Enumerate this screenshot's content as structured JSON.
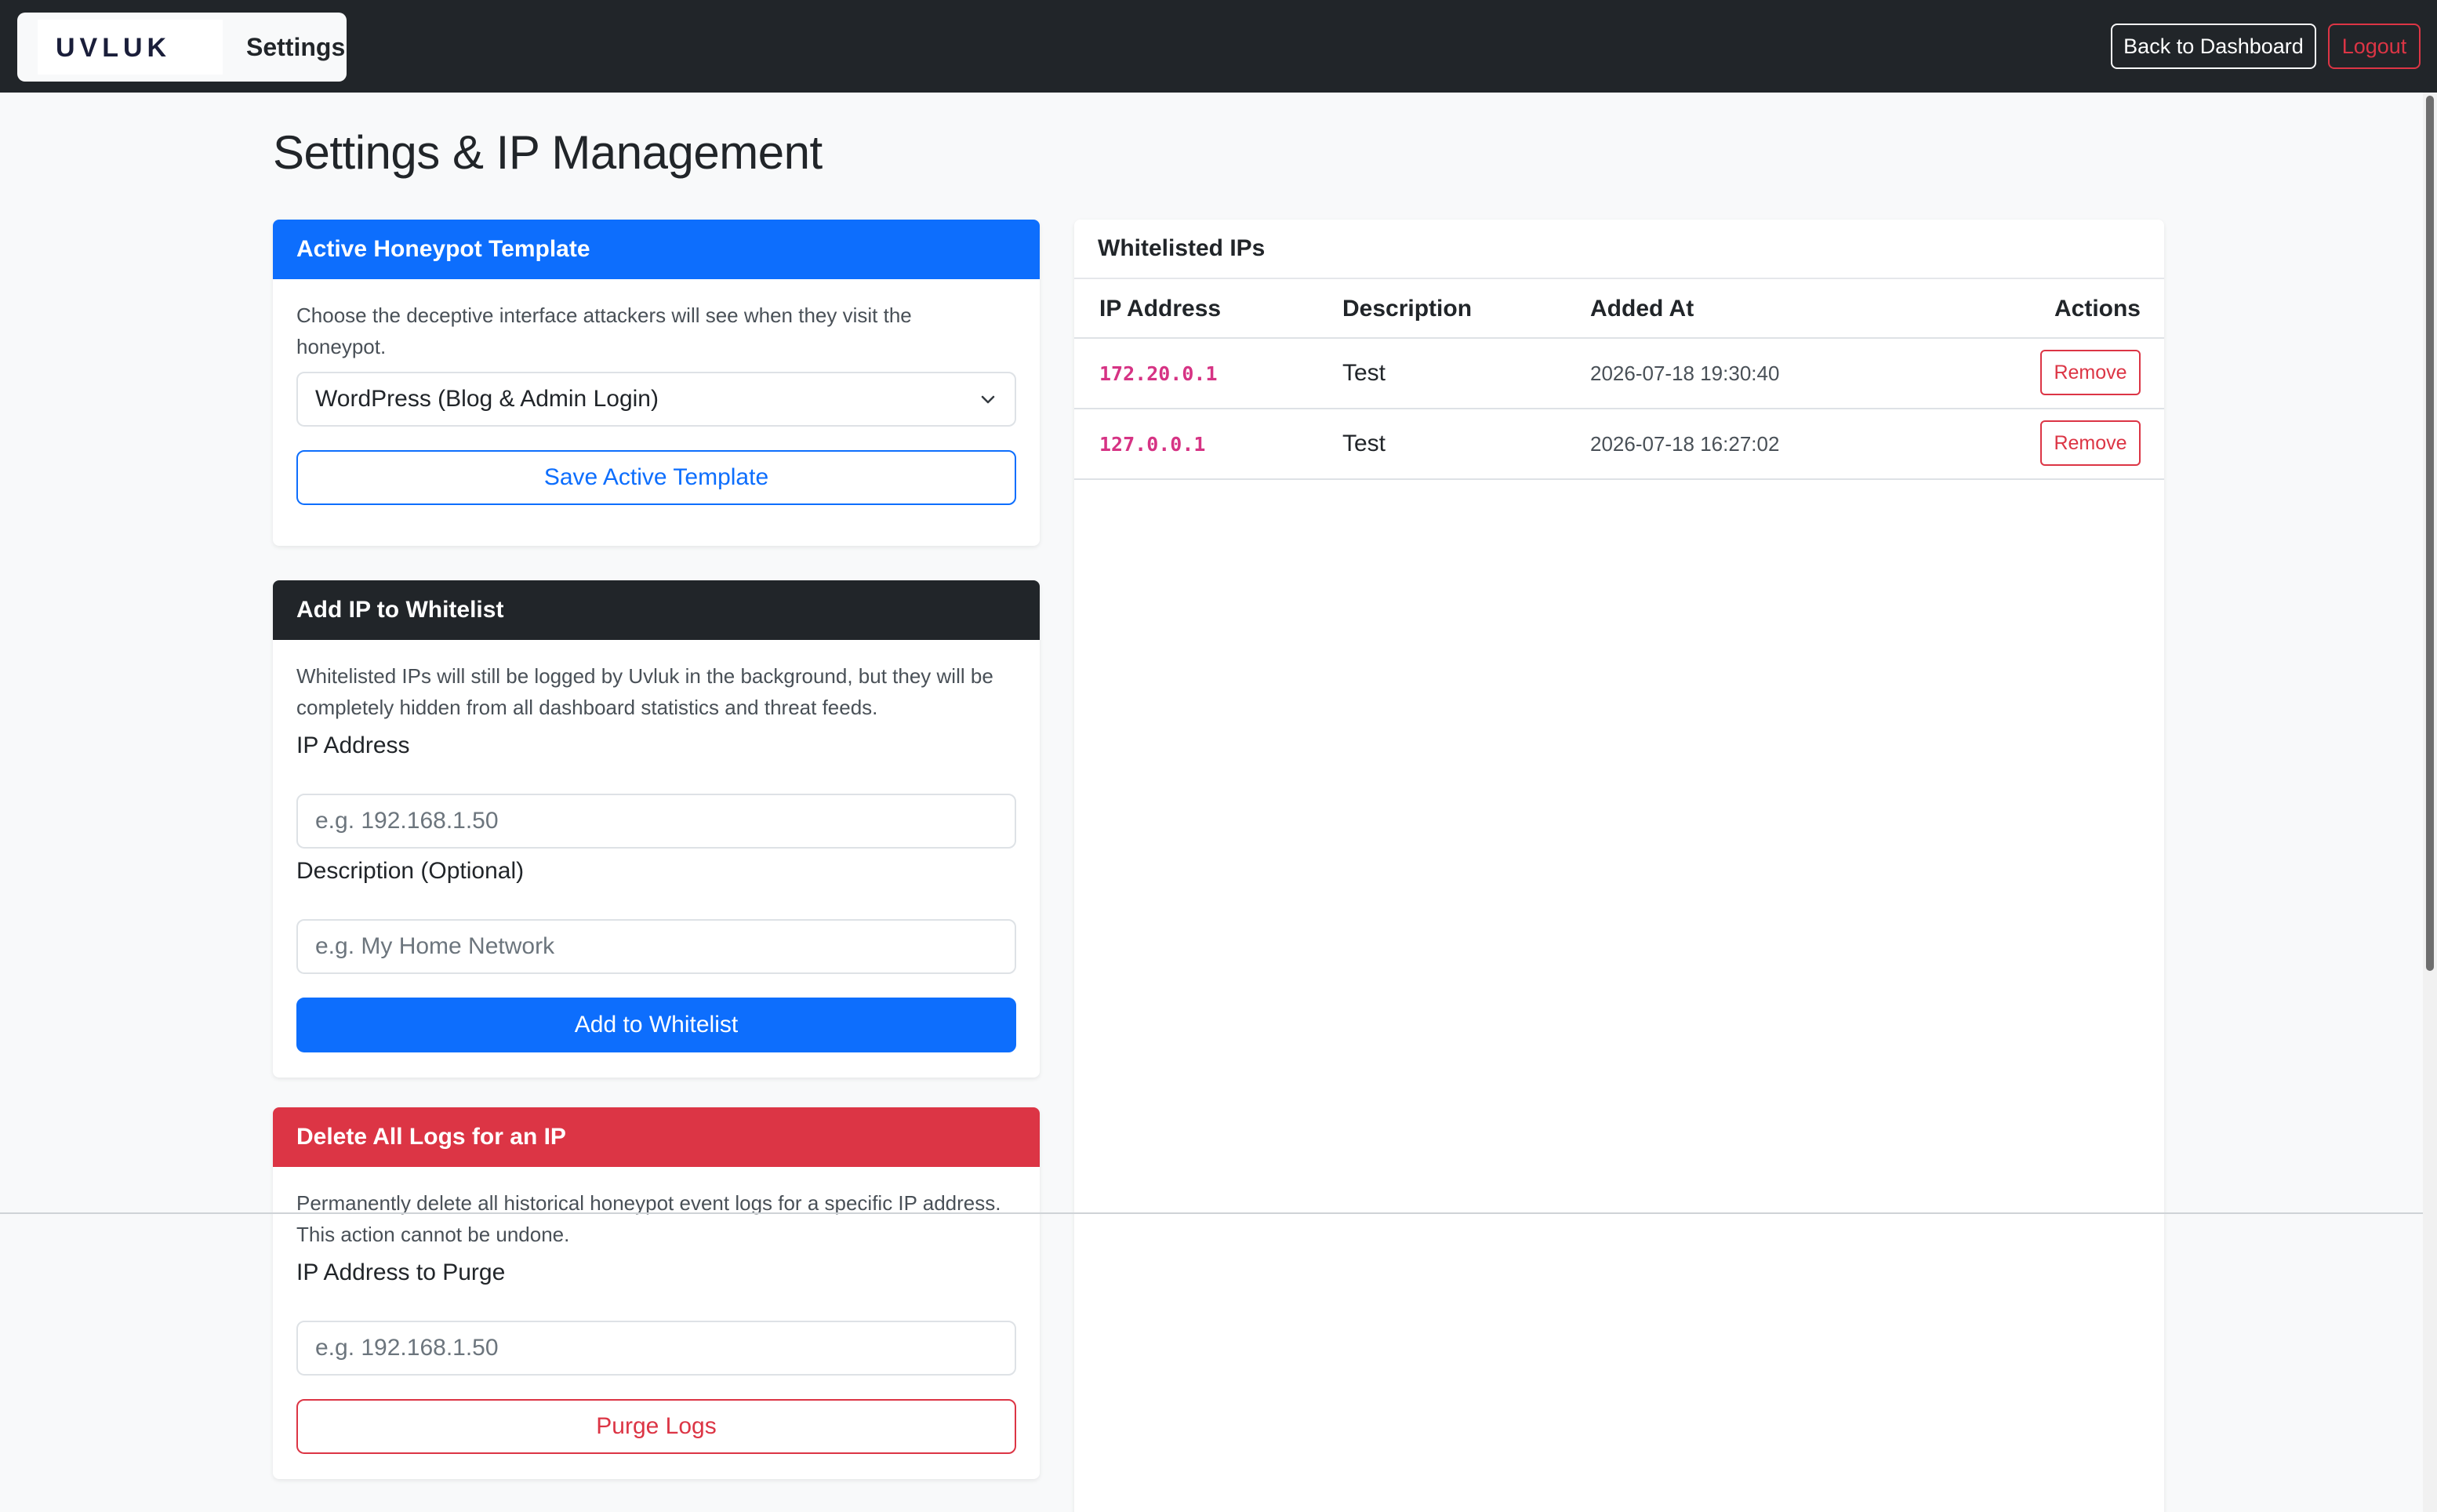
{
  "navbar": {
    "logo_text": "UVLUK",
    "title": "Settings",
    "back_button": "Back to Dashboard",
    "logout_button": "Logout"
  },
  "page_title": "Settings & IP Management",
  "template_card": {
    "header": "Active Honeypot Template",
    "description": "Choose the deceptive interface attackers will see when they visit the honeypot.",
    "selected_template": "WordPress (Blog & Admin Login)",
    "save_button": "Save Active Template"
  },
  "whitelist_card": {
    "header": "Add IP to Whitelist",
    "description": "Whitelisted IPs will still be logged by Uvluk in the background, but they will be completely hidden from all dashboard statistics and threat feeds.",
    "ip_label": "IP Address",
    "ip_placeholder": "e.g. 192.168.1.50",
    "desc_label": "Description (Optional)",
    "desc_placeholder": "e.g. My Home Network",
    "add_button": "Add to Whitelist"
  },
  "purge_card": {
    "header": "Delete All Logs for an IP",
    "description": "Permanently delete all historical honeypot event logs for a specific IP address. This action cannot be undone.",
    "ip_label": "IP Address to Purge",
    "ip_placeholder": "e.g. 192.168.1.50",
    "purge_button": "Purge Logs"
  },
  "whitelisted_table": {
    "header": "Whitelisted IPs",
    "columns": [
      "IP Address",
      "Description",
      "Added At",
      "Actions"
    ],
    "rows": [
      {
        "ip": "172.20.0.1",
        "description": "Test",
        "added_at": "2026-07-18 19:30:40",
        "action": "Remove"
      },
      {
        "ip": "127.0.0.1",
        "description": "Test",
        "added_at": "2026-07-18 16:27:02",
        "action": "Remove"
      }
    ]
  },
  "colors": {
    "primary": "#0d6efd",
    "danger": "#dc3545",
    "dark": "#212529",
    "code_pink": "#d63384"
  }
}
